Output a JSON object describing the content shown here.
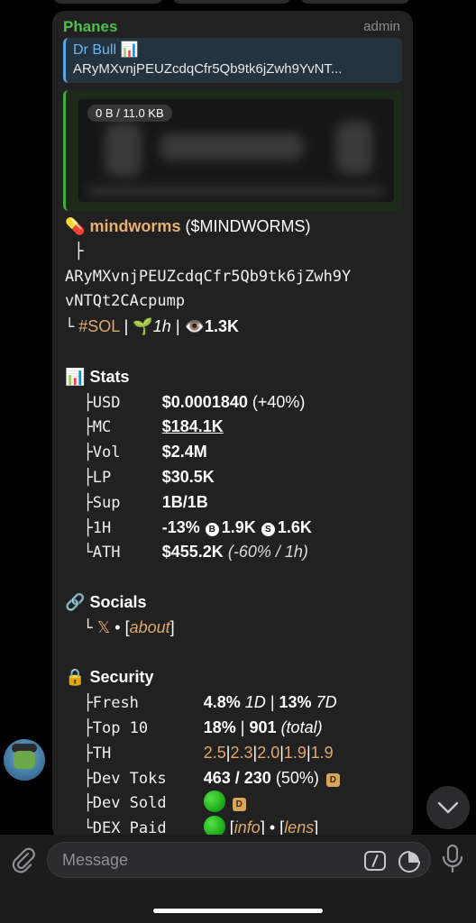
{
  "colors": {
    "sender": "#4fbf4f",
    "reply_accent": "#5aa7e6",
    "token_title": "#e6b170",
    "link": "#e0a86a",
    "status_green": "#22b51a"
  },
  "message": {
    "sender": "Phanes",
    "role": "admin",
    "reply": {
      "name": "Dr Bull 📊",
      "text": "ARyMXvnjPEUZcdqCfr5Qb9tk6jZwh9YvNT..."
    },
    "media": {
      "size_label": "0 B / 11.0 KB"
    }
  },
  "token": {
    "pill_emoji": "💊",
    "name": "mindworms",
    "symbol": "($MINDWORMS)",
    "branch": "├",
    "address_line1": "ARyMXvnjPEUZcdqCfr5Qb9tk6jZwh9Y",
    "address_line2": "vNTQt2CAcpump",
    "corner": "└",
    "chain_tag": "#SOL",
    "sep": "|",
    "age_emoji": "🌱",
    "age": "1h",
    "views_emoji": "👁️",
    "views": "1.3K"
  },
  "stats": {
    "header_emoji": "📊",
    "header": "Stats",
    "rows": [
      {
        "branch": "├",
        "key": "USD",
        "value": "$0.0001840",
        "extra": "(+40%)"
      },
      {
        "branch": "├",
        "key": "MC",
        "value": "$184.1K"
      },
      {
        "branch": "├",
        "key": "Vol",
        "value": "$2.4M"
      },
      {
        "branch": "├",
        "key": "LP",
        "value": "$30.5K"
      },
      {
        "branch": "├",
        "key": "Sup",
        "value": "1B/1B"
      },
      {
        "branch": "├",
        "key": "1H",
        "value": "-13%",
        "buy_icon": "B",
        "buys": "1.9K",
        "sell_icon": "S",
        "sells": "1.6K"
      },
      {
        "branch": "└",
        "key": "ATH",
        "value": "$455.2K",
        "extra": "(-60% / 1h)"
      }
    ]
  },
  "socials": {
    "header_emoji": "🔗",
    "header": "Socials",
    "branch": "└",
    "x_icon": "𝕏",
    "dot": "•",
    "link_open": "[",
    "link": "about",
    "link_close": "]"
  },
  "security": {
    "header_emoji": "🔒",
    "header": "Security",
    "fresh": {
      "branch": "├",
      "key": "Fresh",
      "v1": "4.8%",
      "p1": "1D",
      "sep": "|",
      "v2": "13%",
      "p2": "7D"
    },
    "top10": {
      "branch": "├",
      "key": "Top 10",
      "v1": "18%",
      "sep": "|",
      "v2": "901",
      "note": "(total)"
    },
    "th": {
      "branch": "├",
      "key": "TH",
      "values": [
        "2.5",
        "2.3",
        "2.0",
        "1.9",
        "1.9"
      ],
      "sep": "|"
    },
    "dev_toks": {
      "branch": "├",
      "key": "Dev Toks",
      "value": "463 / 230",
      "pct": "(50%)",
      "badge": "D"
    },
    "dev_sold": {
      "branch": "├",
      "key": "Dev Sold",
      "badge": "D"
    },
    "dex_paid": {
      "branch": "└",
      "key": "DEX Paid",
      "link1": "info",
      "dot": "•",
      "link2": "lens",
      "open": "[",
      "close": "]"
    }
  },
  "composer": {
    "placeholder": "Message"
  }
}
